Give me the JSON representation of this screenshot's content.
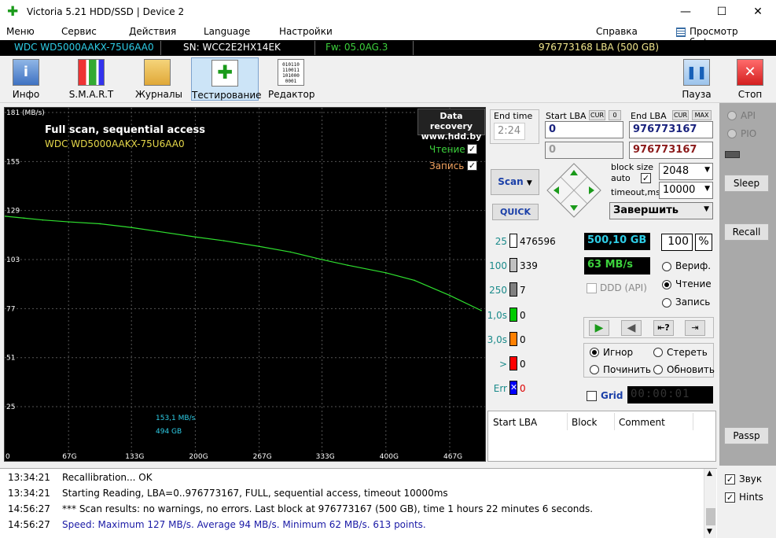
{
  "window": {
    "title": "Victoria 5.21 HDD/SSD | Device 2",
    "minimize": "—",
    "maximize": "☐",
    "close": "✕"
  },
  "menu": {
    "items": [
      "Меню",
      "Сервис",
      "Действия",
      "Language",
      "Настройки",
      "Справка"
    ],
    "buffer": "Просмотр буфера"
  },
  "infobar": {
    "model": "WDC WD5000AAKX-75U6AA0",
    "serial": "SN: WCC2E2HX14EK",
    "firmware": "Fw: 05.0AG.3",
    "capacity": "976773168 LBA (500 GB)"
  },
  "toolbar": {
    "info": "Инфо",
    "smart": "S.M.A.R.T",
    "logs": "Журналы",
    "test": "Тестирование",
    "editor": "Редактор",
    "pause": "Пауза",
    "stop": "Стоп",
    "editor_icon_text": "010110 110011 101000 0001"
  },
  "graph": {
    "title": "Full scan, sequential access",
    "model": "WDC WD5000AAKX-75U6AA0",
    "watermark1": "Data recovery",
    "watermark2": "www.hdd.by",
    "read_label": "Чтение",
    "write_label": "Запись",
    "speed_label": "153,1 MB/s",
    "pos_label": "494 GB",
    "y_ticks": [
      "181 (MB/s)",
      "155",
      "129",
      "103",
      "77",
      "51",
      "25"
    ],
    "x_ticks": [
      "0",
      "67G",
      "133G",
      "200G",
      "267G",
      "333G",
      "400G",
      "467G"
    ]
  },
  "chart_data": {
    "type": "line",
    "xlabel": "",
    "ylabel": "MB/s",
    "ylim": [
      0,
      181
    ],
    "x": [
      0,
      20,
      40,
      67,
      100,
      133,
      160,
      200,
      230,
      267,
      300,
      333,
      360,
      400,
      430,
      467,
      500
    ],
    "series": [
      {
        "name": "Чтение",
        "values": [
          126,
          125,
          124,
          123,
          122,
          120,
          118,
          115,
          113,
          110,
          107,
          103,
          100,
          96,
          92,
          84,
          76
        ]
      }
    ]
  },
  "controls": {
    "end_time_label": "End time",
    "end_time": "2:24",
    "start_lba_label": "Start LBA",
    "cur1": "CUR",
    "zero": "0",
    "end_lba_label": "End LBA",
    "cur2": "CUR",
    "max": "MAX",
    "start_lba": "0",
    "end_lba": "976773167",
    "start_lba2": "0",
    "end_lba2": "976773167",
    "block_size_label": "block size",
    "auto_label": "auto",
    "timeout_label": "timeout,ms",
    "block_size": "2048",
    "timeout": "10000",
    "scan": "Scan",
    "quick": "QUICK",
    "action": "Завершить"
  },
  "histogram": [
    {
      "label": "25",
      "count": "476596",
      "color": "#ffffff"
    },
    {
      "label": "100",
      "count": "339",
      "color": "#c0c0c0"
    },
    {
      "label": "250",
      "count": "7",
      "color": "#808080"
    },
    {
      "label": "1,0s",
      "count": "0",
      "color": "#00cc00"
    },
    {
      "label": "3,0s",
      "count": "0",
      "color": "#ff8000"
    },
    {
      "label": ">",
      "count": "0",
      "color": "#ff0000"
    },
    {
      "label": "Err",
      "count": "0",
      "color": "#0000ff"
    }
  ],
  "stats": {
    "bytes": "500,10 GB",
    "percent": "100",
    "percent_sign": "%",
    "speed": "63 MB/s",
    "ddd": "DDD (API)"
  },
  "modes": {
    "verify": "Вериф.",
    "read": "Чтение",
    "write": "Запись"
  },
  "actions": {
    "ignore": "Игнор",
    "erase": "Стереть",
    "repair": "Починить",
    "refresh": "Обновить"
  },
  "grid": {
    "label": "Grid",
    "timer": "00:00:01"
  },
  "table": {
    "headers": [
      "Start LBA",
      "Block",
      "Comment"
    ]
  },
  "side": {
    "api": "API",
    "pio": "PIO",
    "sleep": "Sleep",
    "recall": "Recall",
    "passp": "Passp",
    "sound": "Звук",
    "hints": "Hints"
  },
  "log": [
    {
      "time": "13:34:21",
      "text": "Recallibration... OK",
      "color": "#000000"
    },
    {
      "time": "13:34:21",
      "text": "Starting Reading, LBA=0..976773167, FULL, sequential access, timeout 10000ms",
      "color": "#000000"
    },
    {
      "time": "14:56:27",
      "text": "*** Scan results: no warnings, no errors. Last block at 976773167 (500 GB), time 1 hours 22 minutes 6 seconds.",
      "color": "#000000"
    },
    {
      "time": "14:56:27",
      "text": "Speed: Maximum 127 MB/s. Average 94 MB/s. Minimum 62 MB/s. 613 points.",
      "color": "#1a1aa6"
    }
  ]
}
